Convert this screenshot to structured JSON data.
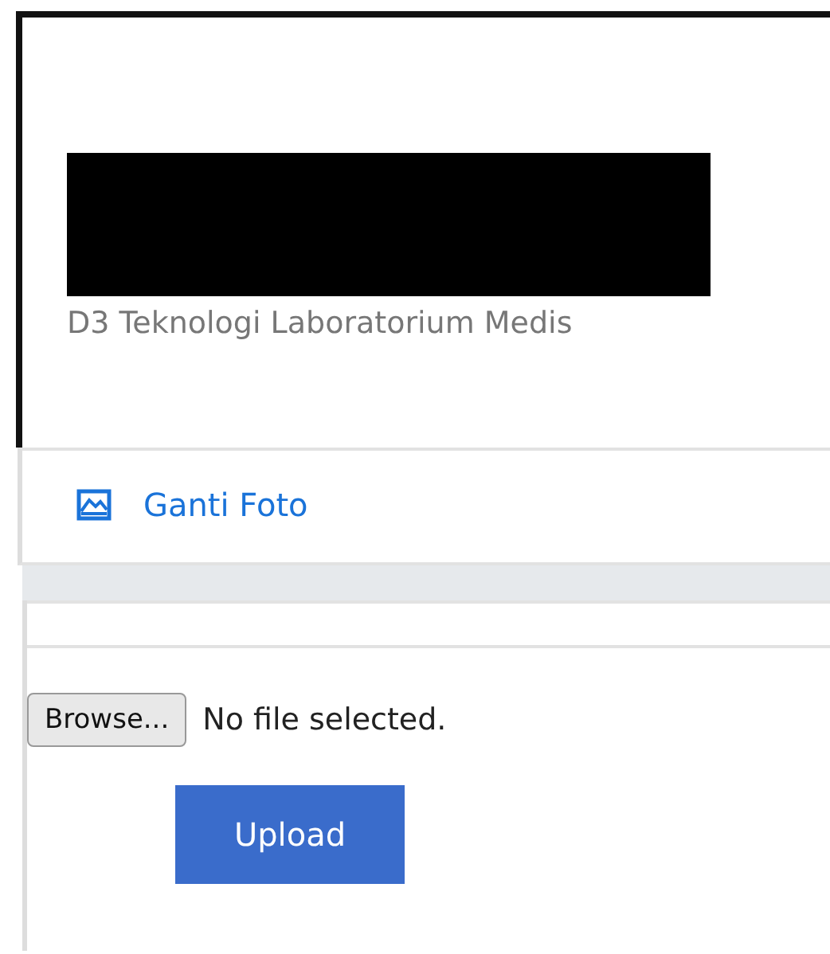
{
  "profile": {
    "program": "D3 Teknologi Laboratorium Medis"
  },
  "menu": [
    {
      "label": "Ganti Foto"
    }
  ],
  "upload": {
    "browse_label": "Browse...",
    "file_status": "No file selected.",
    "submit_label": "Upload"
  }
}
